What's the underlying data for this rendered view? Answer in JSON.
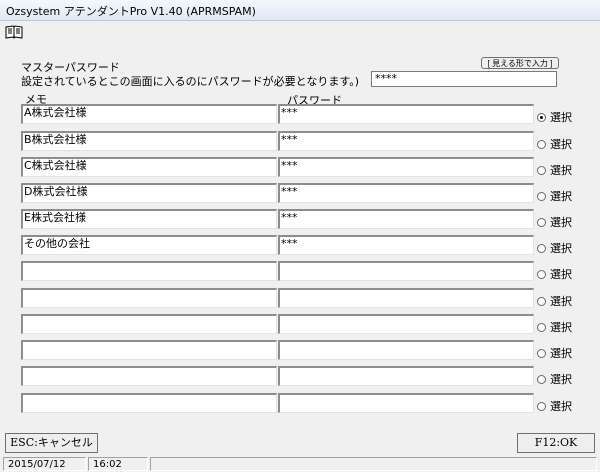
{
  "window": {
    "title": "Ozsystem アテンダントPro V1.40 (APRMSPAM)"
  },
  "toolbar": {
    "book_icon": "book-icon"
  },
  "master": {
    "label": "マスターパスワード",
    "description": "設定されているとこの画面に入るのにパスワードが必要となります。)",
    "visible_button": "[ 見える形で入力 ]",
    "value": "****"
  },
  "columns": {
    "memo": "メモ",
    "password": "パスワード"
  },
  "rows": [
    {
      "memo": "A株式会社様",
      "password": "***",
      "select": "選択",
      "selected": true
    },
    {
      "memo": "B株式会社様",
      "password": "***",
      "select": "選択",
      "selected": false
    },
    {
      "memo": "C株式会社様",
      "password": "***",
      "select": "選択",
      "selected": false
    },
    {
      "memo": "D株式会社様",
      "password": "***",
      "select": "選択",
      "selected": false
    },
    {
      "memo": "E株式会社様",
      "password": "***",
      "select": "選択",
      "selected": false
    },
    {
      "memo": "その他の会社",
      "password": "***",
      "select": "選択",
      "selected": false
    },
    {
      "memo": "",
      "password": "",
      "select": "選択",
      "selected": false
    },
    {
      "memo": "",
      "password": "",
      "select": "選択",
      "selected": false
    },
    {
      "memo": "",
      "password": "",
      "select": "選択",
      "selected": false
    },
    {
      "memo": "",
      "password": "",
      "select": "選択",
      "selected": false
    },
    {
      "memo": "",
      "password": "",
      "select": "選択",
      "selected": false
    },
    {
      "memo": "",
      "password": "",
      "select": "選択",
      "selected": false
    }
  ],
  "buttons": {
    "cancel": "ESC:キャンセル",
    "ok": "F12:OK"
  },
  "status": {
    "date": "2015/07/12",
    "time": "16:02"
  }
}
